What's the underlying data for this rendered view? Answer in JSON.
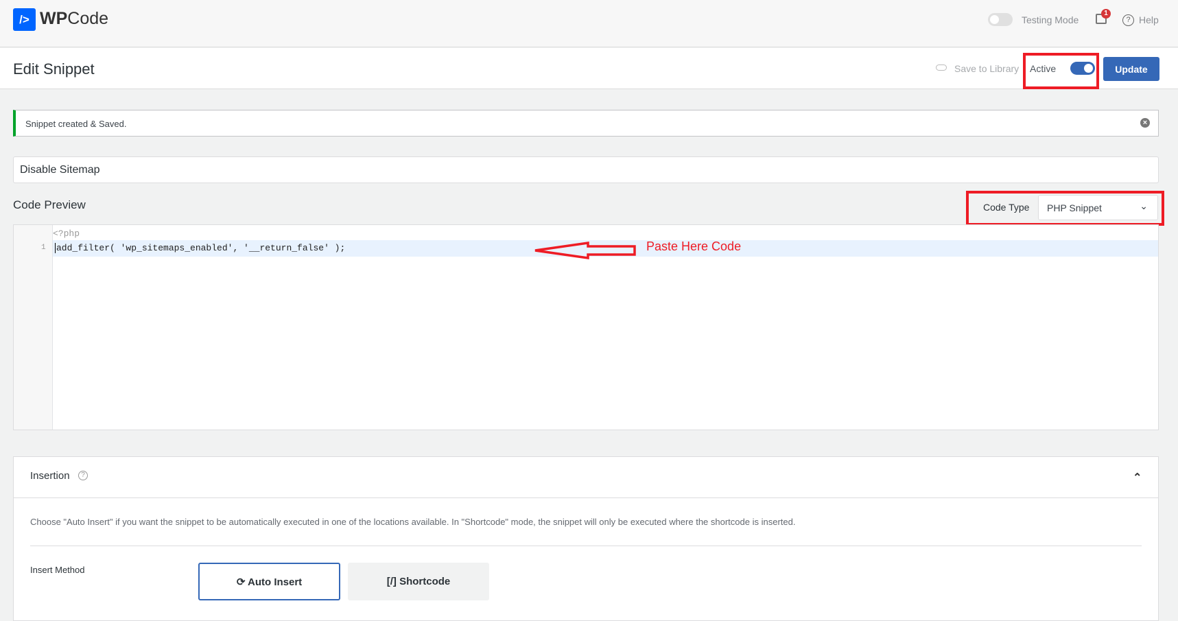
{
  "header": {
    "brand_bold": "WP",
    "brand_rest": "Code",
    "testing_mode_label": "Testing Mode",
    "notification_count": "1",
    "help_label": "Help"
  },
  "editbar": {
    "title": "Edit Snippet",
    "save_to_library": "Save to Library",
    "active_label": "Active",
    "active": true,
    "update_label": "Update"
  },
  "notice": {
    "text": "Snippet created & Saved."
  },
  "snippet": {
    "title": "Disable Sitemap"
  },
  "code_preview": {
    "label": "Code Preview",
    "code_type_label": "Code Type",
    "code_type_value": "PHP Snippet",
    "header_line": "<?php",
    "lines": [
      {
        "number": "1",
        "text": "add_filter( 'wp_sitemaps_enabled', '__return_false' );"
      }
    ]
  },
  "annotation": {
    "text": "Paste Here Code",
    "color": "#ee1c25"
  },
  "insertion": {
    "title": "Insertion",
    "description": "Choose \"Auto Insert\" if you want the snippet to be automatically executed in one of the locations available. In \"Shortcode\" mode, the snippet will only be executed where the shortcode is inserted.",
    "insert_method_label": "Insert Method",
    "auto_insert_label": "Auto Insert",
    "shortcode_label": "[/] Shortcode"
  },
  "colors": {
    "accent": "#3568b7",
    "logo": "#0065ff",
    "success": "#00a32a"
  }
}
